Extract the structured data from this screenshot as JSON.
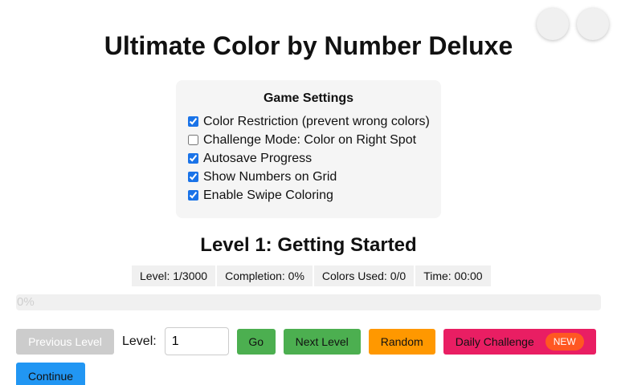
{
  "header": {
    "title": "Ultimate Color by Number Deluxe",
    "corner_button_1_icon": "",
    "corner_button_2_icon": ""
  },
  "settings": {
    "title": "Game Settings",
    "options": [
      {
        "label": "Color Restriction (prevent wrong colors)",
        "checked": true
      },
      {
        "label": "Challenge Mode: Color on Right Spot",
        "checked": false
      },
      {
        "label": "Autosave Progress",
        "checked": true
      },
      {
        "label": "Show Numbers on Grid",
        "checked": true
      },
      {
        "label": "Enable Swipe Coloring",
        "checked": true
      }
    ]
  },
  "level": {
    "title": "Level 1: Getting Started"
  },
  "stats": {
    "level": "Level: 1/3000",
    "completion": "Completion: 0%",
    "colors_used": "Colors Used: 0/0",
    "time": "Time: 00:00"
  },
  "progress": {
    "value": 0,
    "text": "0%"
  },
  "controls": {
    "prev_label": "Previous Level",
    "level_label": "Level:",
    "level_input_value": "1",
    "go_label": "Go",
    "next_label": "Next Level",
    "random_label": "Random",
    "daily_label": "Daily Challenge",
    "daily_badge": "NEW",
    "continue_label": "Continue"
  },
  "colors": {
    "green": "#4caf50",
    "orange": "#ff9800",
    "pink": "#e91e63",
    "blue": "#2196f3",
    "badge": "#ff5722"
  }
}
